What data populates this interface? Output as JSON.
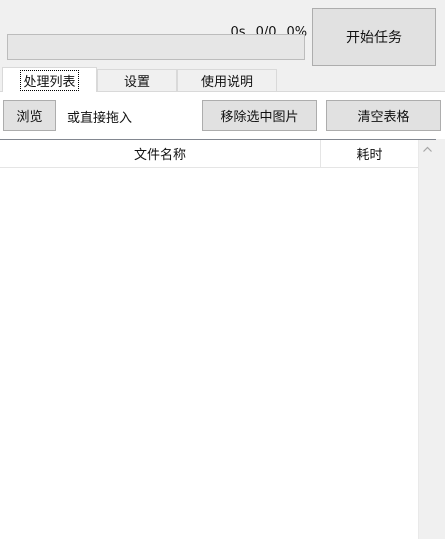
{
  "status": {
    "elapsed": "0s",
    "count": "0/0",
    "percent": "0%"
  },
  "progress": {
    "fraction": 0
  },
  "start_button": {
    "label": "开始任务"
  },
  "tabs": [
    {
      "label": "处理列表",
      "active": true
    },
    {
      "label": "设置",
      "active": false
    },
    {
      "label": "使用说明",
      "active": false
    }
  ],
  "toolbar": {
    "browse_label": "浏览",
    "drag_hint": "或直接拖入",
    "remove_selected_label": "移除选中图片",
    "clear_table_label": "清空表格"
  },
  "table": {
    "columns": [
      "文件名称",
      "耗时"
    ],
    "rows": []
  },
  "icons": {
    "scroll_up": "chevron-up-icon"
  },
  "colors": {
    "window_bg": "#f0f0f0",
    "list_bg": "#ffffff",
    "button_bg": "#e1e1e1"
  }
}
